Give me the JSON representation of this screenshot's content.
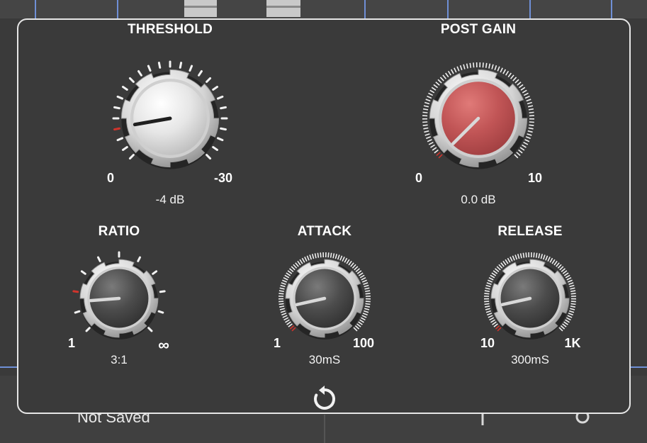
{
  "footer": {
    "save_status": "Not Saved"
  },
  "knobs": {
    "threshold": {
      "label": "THRESHOLD",
      "min_label": "0",
      "max_label": "-30",
      "value": "-4 dB",
      "style": "dots",
      "cap": "white",
      "level": 0.13
    },
    "post_gain": {
      "label": "POST GAIN",
      "min_label": "0",
      "max_label": "10",
      "value": "0.0 dB",
      "style": "ring",
      "cap": "red",
      "level": 0.0
    },
    "ratio": {
      "label": "RATIO",
      "min_label": "1",
      "max_label": "∞",
      "value": "3:1",
      "style": "dots",
      "cap": "dark",
      "level": 0.15
    },
    "attack": {
      "label": "ATTACK",
      "min_label": "1",
      "max_label": "100",
      "value": "30mS",
      "style": "ring",
      "cap": "dark",
      "level": 0.12
    },
    "release": {
      "label": "RELEASE",
      "min_label": "10",
      "max_label": "1K",
      "value": "300mS",
      "style": "ring",
      "cap": "dark",
      "level": 0.12
    }
  },
  "colors": {
    "accent": "#d0342c",
    "panel_border": "#e6e6e6",
    "track_line": "#6f8fd6"
  },
  "icons": {
    "reset": "reset-icon"
  }
}
